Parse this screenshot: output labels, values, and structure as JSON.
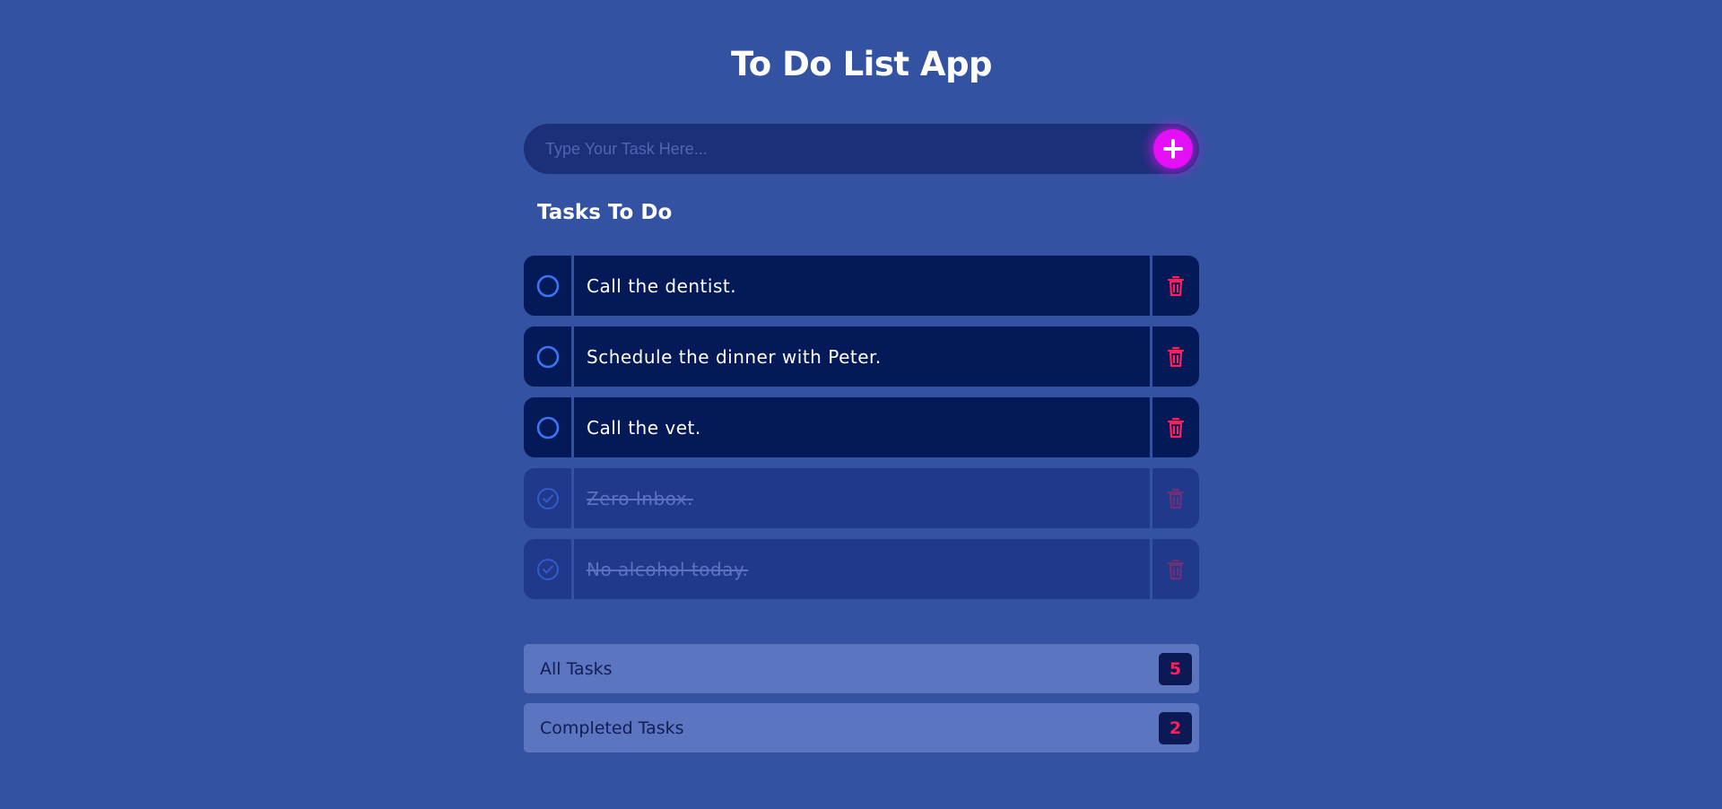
{
  "app": {
    "title": "To Do List App"
  },
  "input": {
    "placeholder": "Type Your Task Here...",
    "add_icon": "plus-icon"
  },
  "section": {
    "title": "Tasks To Do"
  },
  "tasks": [
    {
      "text": "Call the dentist.",
      "completed": false
    },
    {
      "text": "Schedule the dinner with Peter.",
      "completed": false
    },
    {
      "text": "Call the vet.",
      "completed": false
    },
    {
      "text": "Zero Inbox.",
      "completed": true
    },
    {
      "text": "No alcohol today.",
      "completed": true
    }
  ],
  "summary": {
    "all_label": "All Tasks",
    "all_count": "5",
    "completed_label": "Completed Tasks",
    "completed_count": "2"
  },
  "icons": {
    "check": "circle-icon",
    "check_done": "check-circle-icon",
    "delete": "trash-icon"
  },
  "colors": {
    "background": "#3452a2",
    "task_bg": "#041958",
    "task_done_bg": "#21398a",
    "accent_add": "#e50ff5",
    "delete": "#ff1f5a",
    "check": "#3d74f5"
  }
}
